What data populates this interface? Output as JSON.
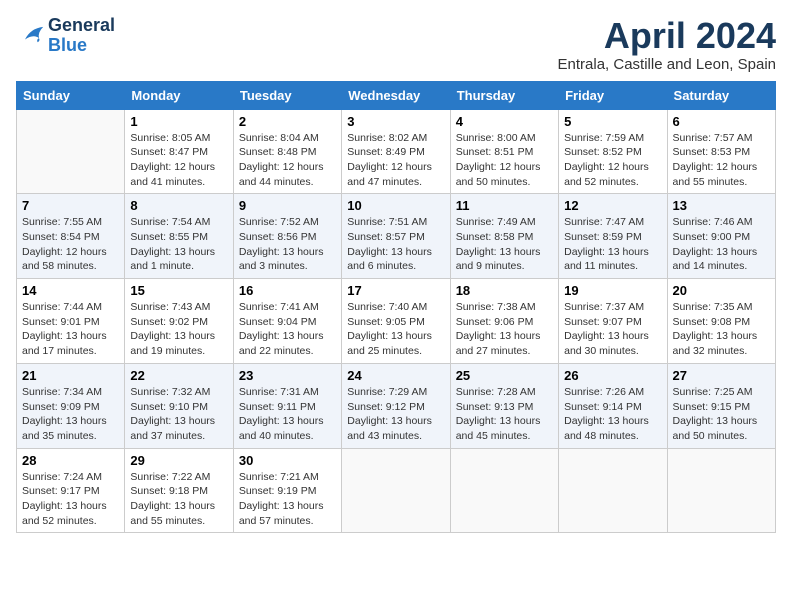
{
  "header": {
    "logo_line1": "General",
    "logo_line2": "Blue",
    "month_title": "April 2024",
    "subtitle": "Entrala, Castille and Leon, Spain"
  },
  "columns": [
    "Sunday",
    "Monday",
    "Tuesday",
    "Wednesday",
    "Thursday",
    "Friday",
    "Saturday"
  ],
  "weeks": [
    [
      {
        "day": "",
        "info": ""
      },
      {
        "day": "1",
        "info": "Sunrise: 8:05 AM\nSunset: 8:47 PM\nDaylight: 12 hours\nand 41 minutes."
      },
      {
        "day": "2",
        "info": "Sunrise: 8:04 AM\nSunset: 8:48 PM\nDaylight: 12 hours\nand 44 minutes."
      },
      {
        "day": "3",
        "info": "Sunrise: 8:02 AM\nSunset: 8:49 PM\nDaylight: 12 hours\nand 47 minutes."
      },
      {
        "day": "4",
        "info": "Sunrise: 8:00 AM\nSunset: 8:51 PM\nDaylight: 12 hours\nand 50 minutes."
      },
      {
        "day": "5",
        "info": "Sunrise: 7:59 AM\nSunset: 8:52 PM\nDaylight: 12 hours\nand 52 minutes."
      },
      {
        "day": "6",
        "info": "Sunrise: 7:57 AM\nSunset: 8:53 PM\nDaylight: 12 hours\nand 55 minutes."
      }
    ],
    [
      {
        "day": "7",
        "info": "Sunrise: 7:55 AM\nSunset: 8:54 PM\nDaylight: 12 hours\nand 58 minutes."
      },
      {
        "day": "8",
        "info": "Sunrise: 7:54 AM\nSunset: 8:55 PM\nDaylight: 13 hours\nand 1 minute."
      },
      {
        "day": "9",
        "info": "Sunrise: 7:52 AM\nSunset: 8:56 PM\nDaylight: 13 hours\nand 3 minutes."
      },
      {
        "day": "10",
        "info": "Sunrise: 7:51 AM\nSunset: 8:57 PM\nDaylight: 13 hours\nand 6 minutes."
      },
      {
        "day": "11",
        "info": "Sunrise: 7:49 AM\nSunset: 8:58 PM\nDaylight: 13 hours\nand 9 minutes."
      },
      {
        "day": "12",
        "info": "Sunrise: 7:47 AM\nSunset: 8:59 PM\nDaylight: 13 hours\nand 11 minutes."
      },
      {
        "day": "13",
        "info": "Sunrise: 7:46 AM\nSunset: 9:00 PM\nDaylight: 13 hours\nand 14 minutes."
      }
    ],
    [
      {
        "day": "14",
        "info": "Sunrise: 7:44 AM\nSunset: 9:01 PM\nDaylight: 13 hours\nand 17 minutes."
      },
      {
        "day": "15",
        "info": "Sunrise: 7:43 AM\nSunset: 9:02 PM\nDaylight: 13 hours\nand 19 minutes."
      },
      {
        "day": "16",
        "info": "Sunrise: 7:41 AM\nSunset: 9:04 PM\nDaylight: 13 hours\nand 22 minutes."
      },
      {
        "day": "17",
        "info": "Sunrise: 7:40 AM\nSunset: 9:05 PM\nDaylight: 13 hours\nand 25 minutes."
      },
      {
        "day": "18",
        "info": "Sunrise: 7:38 AM\nSunset: 9:06 PM\nDaylight: 13 hours\nand 27 minutes."
      },
      {
        "day": "19",
        "info": "Sunrise: 7:37 AM\nSunset: 9:07 PM\nDaylight: 13 hours\nand 30 minutes."
      },
      {
        "day": "20",
        "info": "Sunrise: 7:35 AM\nSunset: 9:08 PM\nDaylight: 13 hours\nand 32 minutes."
      }
    ],
    [
      {
        "day": "21",
        "info": "Sunrise: 7:34 AM\nSunset: 9:09 PM\nDaylight: 13 hours\nand 35 minutes."
      },
      {
        "day": "22",
        "info": "Sunrise: 7:32 AM\nSunset: 9:10 PM\nDaylight: 13 hours\nand 37 minutes."
      },
      {
        "day": "23",
        "info": "Sunrise: 7:31 AM\nSunset: 9:11 PM\nDaylight: 13 hours\nand 40 minutes."
      },
      {
        "day": "24",
        "info": "Sunrise: 7:29 AM\nSunset: 9:12 PM\nDaylight: 13 hours\nand 43 minutes."
      },
      {
        "day": "25",
        "info": "Sunrise: 7:28 AM\nSunset: 9:13 PM\nDaylight: 13 hours\nand 45 minutes."
      },
      {
        "day": "26",
        "info": "Sunrise: 7:26 AM\nSunset: 9:14 PM\nDaylight: 13 hours\nand 48 minutes."
      },
      {
        "day": "27",
        "info": "Sunrise: 7:25 AM\nSunset: 9:15 PM\nDaylight: 13 hours\nand 50 minutes."
      }
    ],
    [
      {
        "day": "28",
        "info": "Sunrise: 7:24 AM\nSunset: 9:17 PM\nDaylight: 13 hours\nand 52 minutes."
      },
      {
        "day": "29",
        "info": "Sunrise: 7:22 AM\nSunset: 9:18 PM\nDaylight: 13 hours\nand 55 minutes."
      },
      {
        "day": "30",
        "info": "Sunrise: 7:21 AM\nSunset: 9:19 PM\nDaylight: 13 hours\nand 57 minutes."
      },
      {
        "day": "",
        "info": ""
      },
      {
        "day": "",
        "info": ""
      },
      {
        "day": "",
        "info": ""
      },
      {
        "day": "",
        "info": ""
      }
    ]
  ]
}
